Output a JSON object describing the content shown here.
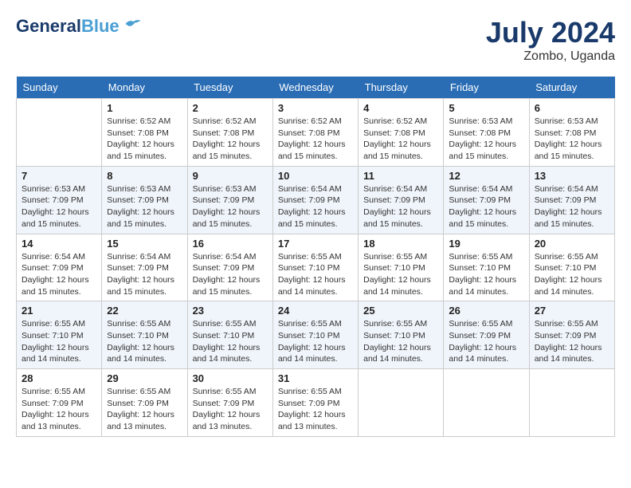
{
  "header": {
    "logo_general": "General",
    "logo_blue": "Blue",
    "month_year": "July 2024",
    "location": "Zombo, Uganda"
  },
  "weekdays": [
    "Sunday",
    "Monday",
    "Tuesday",
    "Wednesday",
    "Thursday",
    "Friday",
    "Saturday"
  ],
  "weeks": [
    [
      {
        "day": "",
        "sunrise": "",
        "sunset": "",
        "daylight": ""
      },
      {
        "day": "1",
        "sunrise": "Sunrise: 6:52 AM",
        "sunset": "Sunset: 7:08 PM",
        "daylight": "Daylight: 12 hours and 15 minutes."
      },
      {
        "day": "2",
        "sunrise": "Sunrise: 6:52 AM",
        "sunset": "Sunset: 7:08 PM",
        "daylight": "Daylight: 12 hours and 15 minutes."
      },
      {
        "day": "3",
        "sunrise": "Sunrise: 6:52 AM",
        "sunset": "Sunset: 7:08 PM",
        "daylight": "Daylight: 12 hours and 15 minutes."
      },
      {
        "day": "4",
        "sunrise": "Sunrise: 6:52 AM",
        "sunset": "Sunset: 7:08 PM",
        "daylight": "Daylight: 12 hours and 15 minutes."
      },
      {
        "day": "5",
        "sunrise": "Sunrise: 6:53 AM",
        "sunset": "Sunset: 7:08 PM",
        "daylight": "Daylight: 12 hours and 15 minutes."
      },
      {
        "day": "6",
        "sunrise": "Sunrise: 6:53 AM",
        "sunset": "Sunset: 7:08 PM",
        "daylight": "Daylight: 12 hours and 15 minutes."
      }
    ],
    [
      {
        "day": "7",
        "sunrise": "Sunrise: 6:53 AM",
        "sunset": "Sunset: 7:09 PM",
        "daylight": "Daylight: 12 hours and 15 minutes."
      },
      {
        "day": "8",
        "sunrise": "Sunrise: 6:53 AM",
        "sunset": "Sunset: 7:09 PM",
        "daylight": "Daylight: 12 hours and 15 minutes."
      },
      {
        "day": "9",
        "sunrise": "Sunrise: 6:53 AM",
        "sunset": "Sunset: 7:09 PM",
        "daylight": "Daylight: 12 hours and 15 minutes."
      },
      {
        "day": "10",
        "sunrise": "Sunrise: 6:54 AM",
        "sunset": "Sunset: 7:09 PM",
        "daylight": "Daylight: 12 hours and 15 minutes."
      },
      {
        "day": "11",
        "sunrise": "Sunrise: 6:54 AM",
        "sunset": "Sunset: 7:09 PM",
        "daylight": "Daylight: 12 hours and 15 minutes."
      },
      {
        "day": "12",
        "sunrise": "Sunrise: 6:54 AM",
        "sunset": "Sunset: 7:09 PM",
        "daylight": "Daylight: 12 hours and 15 minutes."
      },
      {
        "day": "13",
        "sunrise": "Sunrise: 6:54 AM",
        "sunset": "Sunset: 7:09 PM",
        "daylight": "Daylight: 12 hours and 15 minutes."
      }
    ],
    [
      {
        "day": "14",
        "sunrise": "Sunrise: 6:54 AM",
        "sunset": "Sunset: 7:09 PM",
        "daylight": "Daylight: 12 hours and 15 minutes."
      },
      {
        "day": "15",
        "sunrise": "Sunrise: 6:54 AM",
        "sunset": "Sunset: 7:09 PM",
        "daylight": "Daylight: 12 hours and 15 minutes."
      },
      {
        "day": "16",
        "sunrise": "Sunrise: 6:54 AM",
        "sunset": "Sunset: 7:09 PM",
        "daylight": "Daylight: 12 hours and 15 minutes."
      },
      {
        "day": "17",
        "sunrise": "Sunrise: 6:55 AM",
        "sunset": "Sunset: 7:10 PM",
        "daylight": "Daylight: 12 hours and 14 minutes."
      },
      {
        "day": "18",
        "sunrise": "Sunrise: 6:55 AM",
        "sunset": "Sunset: 7:10 PM",
        "daylight": "Daylight: 12 hours and 14 minutes."
      },
      {
        "day": "19",
        "sunrise": "Sunrise: 6:55 AM",
        "sunset": "Sunset: 7:10 PM",
        "daylight": "Daylight: 12 hours and 14 minutes."
      },
      {
        "day": "20",
        "sunrise": "Sunrise: 6:55 AM",
        "sunset": "Sunset: 7:10 PM",
        "daylight": "Daylight: 12 hours and 14 minutes."
      }
    ],
    [
      {
        "day": "21",
        "sunrise": "Sunrise: 6:55 AM",
        "sunset": "Sunset: 7:10 PM",
        "daylight": "Daylight: 12 hours and 14 minutes."
      },
      {
        "day": "22",
        "sunrise": "Sunrise: 6:55 AM",
        "sunset": "Sunset: 7:10 PM",
        "daylight": "Daylight: 12 hours and 14 minutes."
      },
      {
        "day": "23",
        "sunrise": "Sunrise: 6:55 AM",
        "sunset": "Sunset: 7:10 PM",
        "daylight": "Daylight: 12 hours and 14 minutes."
      },
      {
        "day": "24",
        "sunrise": "Sunrise: 6:55 AM",
        "sunset": "Sunset: 7:10 PM",
        "daylight": "Daylight: 12 hours and 14 minutes."
      },
      {
        "day": "25",
        "sunrise": "Sunrise: 6:55 AM",
        "sunset": "Sunset: 7:10 PM",
        "daylight": "Daylight: 12 hours and 14 minutes."
      },
      {
        "day": "26",
        "sunrise": "Sunrise: 6:55 AM",
        "sunset": "Sunset: 7:09 PM",
        "daylight": "Daylight: 12 hours and 14 minutes."
      },
      {
        "day": "27",
        "sunrise": "Sunrise: 6:55 AM",
        "sunset": "Sunset: 7:09 PM",
        "daylight": "Daylight: 12 hours and 14 minutes."
      }
    ],
    [
      {
        "day": "28",
        "sunrise": "Sunrise: 6:55 AM",
        "sunset": "Sunset: 7:09 PM",
        "daylight": "Daylight: 12 hours and 13 minutes."
      },
      {
        "day": "29",
        "sunrise": "Sunrise: 6:55 AM",
        "sunset": "Sunset: 7:09 PM",
        "daylight": "Daylight: 12 hours and 13 minutes."
      },
      {
        "day": "30",
        "sunrise": "Sunrise: 6:55 AM",
        "sunset": "Sunset: 7:09 PM",
        "daylight": "Daylight: 12 hours and 13 minutes."
      },
      {
        "day": "31",
        "sunrise": "Sunrise: 6:55 AM",
        "sunset": "Sunset: 7:09 PM",
        "daylight": "Daylight: 12 hours and 13 minutes."
      },
      {
        "day": "",
        "sunrise": "",
        "sunset": "",
        "daylight": ""
      },
      {
        "day": "",
        "sunrise": "",
        "sunset": "",
        "daylight": ""
      },
      {
        "day": "",
        "sunrise": "",
        "sunset": "",
        "daylight": ""
      }
    ]
  ]
}
